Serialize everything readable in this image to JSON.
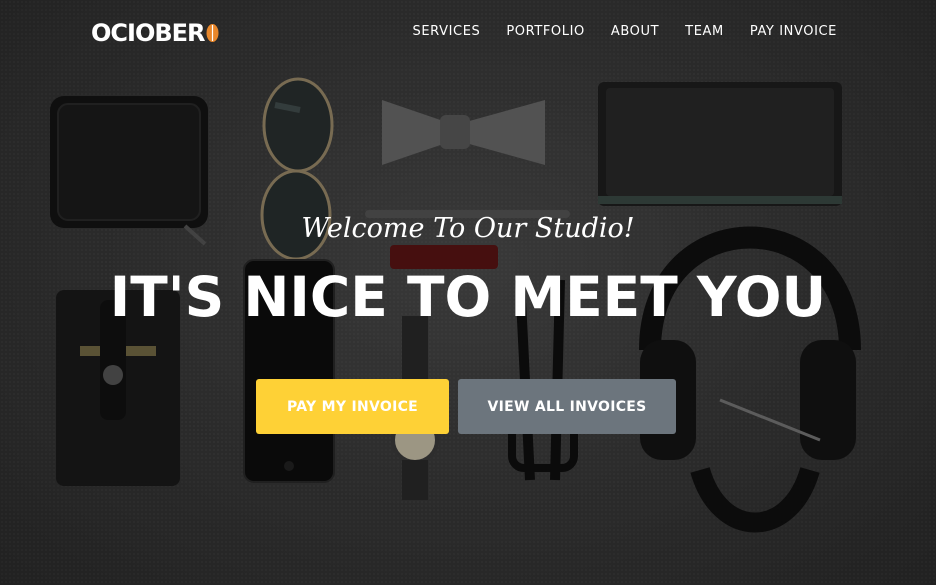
{
  "brand": {
    "logo_text": "OCIOBER",
    "accent_color": "#e8872b"
  },
  "nav": {
    "items": [
      {
        "label": "SERVICES"
      },
      {
        "label": "PORTFOLIO"
      },
      {
        "label": "ABOUT"
      },
      {
        "label": "TEAM"
      },
      {
        "label": "PAY INVOICE"
      }
    ]
  },
  "hero": {
    "subheading": "Welcome To Our Studio!",
    "heading": "IT'S NICE TO MEET YOU",
    "primary_button": {
      "label": "PAY MY INVOICE",
      "color": "#fed136"
    },
    "secondary_button": {
      "label": "VIEW ALL INVOICES",
      "color": "#6c757d"
    }
  }
}
